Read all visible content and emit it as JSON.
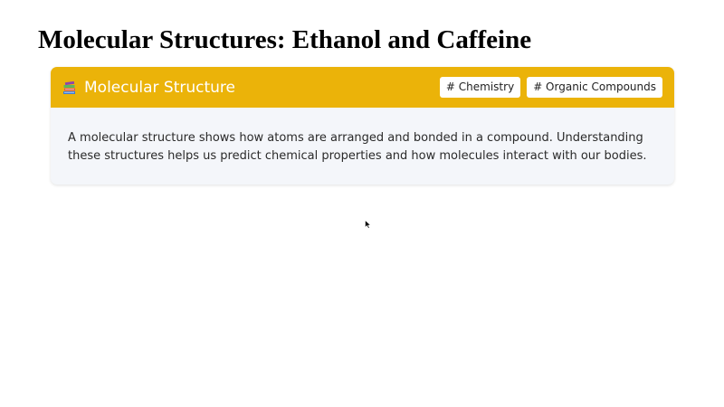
{
  "page": {
    "title": "Molecular Structures: Ethanol and Caffeine"
  },
  "card": {
    "icon": "books-icon",
    "title": "Molecular Structure",
    "tags": [
      "# Chemistry",
      "# Organic Compounds"
    ],
    "description": "A molecular structure shows how atoms are arranged and bonded in a compound. Understanding these structures helps us predict chemical properties and how molecules interact with our bodies.",
    "colors": {
      "header": "#ebb309",
      "body": "#f4f6fa"
    }
  }
}
